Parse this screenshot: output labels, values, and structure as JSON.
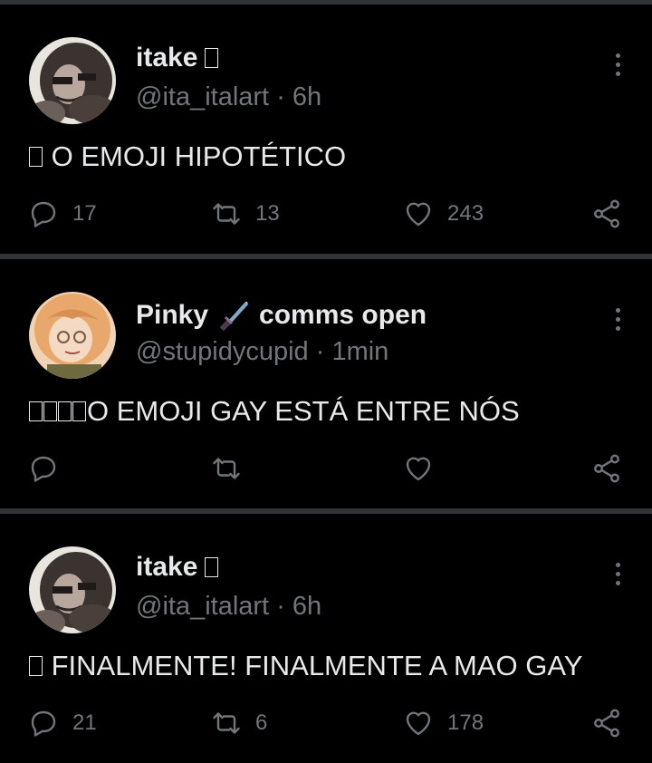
{
  "tweets": [
    {
      "name": "itake",
      "name_emoji": "▯",
      "handle": "@ita_italart",
      "time": "6h",
      "text": "O EMOJI HIPOTÉTICO",
      "text_emoji_count": 1,
      "reply_count": "17",
      "retweet_count": "13",
      "like_count": "243"
    },
    {
      "name": "Pinky",
      "name_suffix": "comms open",
      "name_emoji": "dagger-icon",
      "handle": "@stupidycupid",
      "time": "1min",
      "text": "O EMOJI GAY ESTÁ ENTRE NÓS",
      "text_emoji_count": 4,
      "reply_count": "",
      "retweet_count": "",
      "like_count": ""
    },
    {
      "name": "itake",
      "name_emoji": "▯",
      "handle": "@ita_italart",
      "time": "6h",
      "text": "FINALMENTE! FINALMENTE A MAO GAY",
      "text_emoji_count": 1,
      "reply_count": "21",
      "retweet_count": "6",
      "like_count": "178"
    }
  ],
  "separator_dot": "·",
  "colors": {
    "background": "#000000",
    "text": "#e7e9ea",
    "muted": "#71767b",
    "separator": "#2f3336"
  }
}
